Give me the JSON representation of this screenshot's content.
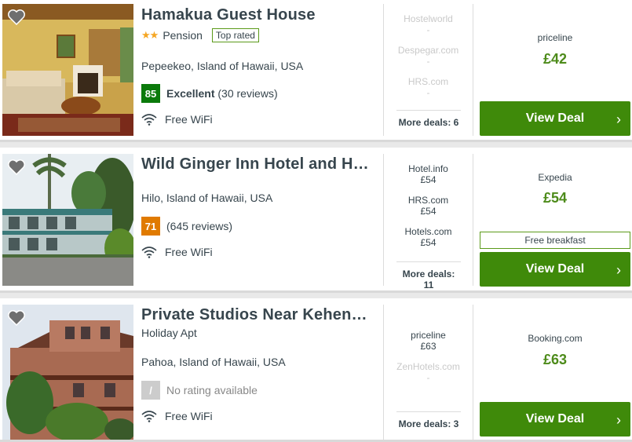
{
  "colors": {
    "accent": "#3f8a0a",
    "price": "#4d8b1a",
    "score_excellent": "#0b7a0b",
    "score_good": "#e07a00",
    "score_none": "#cccccc"
  },
  "hotels": [
    {
      "name": "Hamakua Guest House",
      "stars": "★★",
      "type": "Pension",
      "badge": "Top rated",
      "location": "Pepeekeo, Island of Hawaii, USA",
      "score": "85",
      "rating_label": "Excellent",
      "reviews": "(30 reviews)",
      "amenity": "Free WiFi",
      "deals": [
        {
          "site": "Hostelworld",
          "price": "-"
        },
        {
          "site": "Despegar.com",
          "price": "-"
        },
        {
          "site": "HRS.com",
          "price": "-"
        }
      ],
      "more_deals": "More deals: 6",
      "best_site": "priceline",
      "best_price": "£42",
      "button": "View Deal"
    },
    {
      "name": "Wild Ginger Inn Hotel and Hostel",
      "location": "Hilo, Island of Hawaii, USA",
      "score": "71",
      "reviews": "(645 reviews)",
      "amenity": "Free WiFi",
      "deals": [
        {
          "site": "Hotel.info",
          "price": "£54"
        },
        {
          "site": "HRS.com",
          "price": "£54"
        },
        {
          "site": "Hotels.com",
          "price": "£54"
        }
      ],
      "more_deals": "More deals: 11",
      "best_site": "Expedia",
      "best_price": "£54",
      "perk": "Free breakfast",
      "button": "View Deal"
    },
    {
      "name": "Private Studios Near Kehena Beach",
      "type": "Holiday Apt",
      "location": "Pahoa, Island of Hawaii, USA",
      "score": "/",
      "rating_label": "No rating available",
      "amenity": "Free WiFi",
      "deals": [
        {
          "site": "priceline",
          "price": "£63"
        },
        {
          "site": "ZenHotels.com",
          "price": "-"
        }
      ],
      "more_deals": "More deals: 3",
      "best_site": "Booking.com",
      "best_price": "£63",
      "button": "View Deal"
    }
  ]
}
